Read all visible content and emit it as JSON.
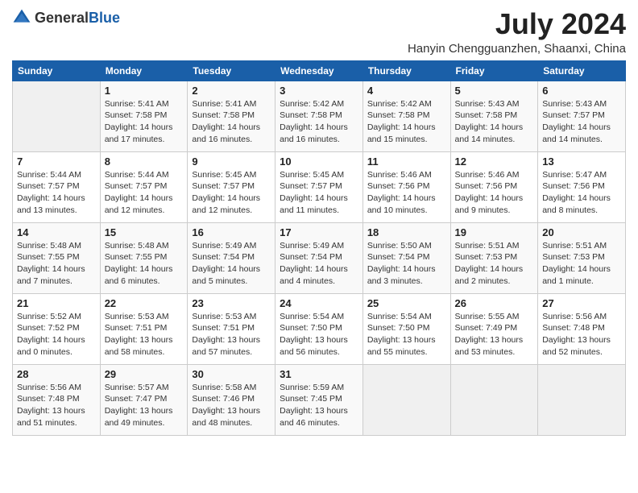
{
  "logo": {
    "general": "General",
    "blue": "Blue"
  },
  "header": {
    "month": "July 2024",
    "location": "Hanyin Chengguanzhen, Shaanxi, China"
  },
  "weekdays": [
    "Sunday",
    "Monday",
    "Tuesday",
    "Wednesday",
    "Thursday",
    "Friday",
    "Saturday"
  ],
  "weeks": [
    [
      {
        "day": "",
        "sunrise": "",
        "sunset": "",
        "daylight": ""
      },
      {
        "day": "1",
        "sunrise": "Sunrise: 5:41 AM",
        "sunset": "Sunset: 7:58 PM",
        "daylight": "Daylight: 14 hours and 17 minutes."
      },
      {
        "day": "2",
        "sunrise": "Sunrise: 5:41 AM",
        "sunset": "Sunset: 7:58 PM",
        "daylight": "Daylight: 14 hours and 16 minutes."
      },
      {
        "day": "3",
        "sunrise": "Sunrise: 5:42 AM",
        "sunset": "Sunset: 7:58 PM",
        "daylight": "Daylight: 14 hours and 16 minutes."
      },
      {
        "day": "4",
        "sunrise": "Sunrise: 5:42 AM",
        "sunset": "Sunset: 7:58 PM",
        "daylight": "Daylight: 14 hours and 15 minutes."
      },
      {
        "day": "5",
        "sunrise": "Sunrise: 5:43 AM",
        "sunset": "Sunset: 7:58 PM",
        "daylight": "Daylight: 14 hours and 14 minutes."
      },
      {
        "day": "6",
        "sunrise": "Sunrise: 5:43 AM",
        "sunset": "Sunset: 7:57 PM",
        "daylight": "Daylight: 14 hours and 14 minutes."
      }
    ],
    [
      {
        "day": "7",
        "sunrise": "Sunrise: 5:44 AM",
        "sunset": "Sunset: 7:57 PM",
        "daylight": "Daylight: 14 hours and 13 minutes."
      },
      {
        "day": "8",
        "sunrise": "Sunrise: 5:44 AM",
        "sunset": "Sunset: 7:57 PM",
        "daylight": "Daylight: 14 hours and 12 minutes."
      },
      {
        "day": "9",
        "sunrise": "Sunrise: 5:45 AM",
        "sunset": "Sunset: 7:57 PM",
        "daylight": "Daylight: 14 hours and 12 minutes."
      },
      {
        "day": "10",
        "sunrise": "Sunrise: 5:45 AM",
        "sunset": "Sunset: 7:57 PM",
        "daylight": "Daylight: 14 hours and 11 minutes."
      },
      {
        "day": "11",
        "sunrise": "Sunrise: 5:46 AM",
        "sunset": "Sunset: 7:56 PM",
        "daylight": "Daylight: 14 hours and 10 minutes."
      },
      {
        "day": "12",
        "sunrise": "Sunrise: 5:46 AM",
        "sunset": "Sunset: 7:56 PM",
        "daylight": "Daylight: 14 hours and 9 minutes."
      },
      {
        "day": "13",
        "sunrise": "Sunrise: 5:47 AM",
        "sunset": "Sunset: 7:56 PM",
        "daylight": "Daylight: 14 hours and 8 minutes."
      }
    ],
    [
      {
        "day": "14",
        "sunrise": "Sunrise: 5:48 AM",
        "sunset": "Sunset: 7:55 PM",
        "daylight": "Daylight: 14 hours and 7 minutes."
      },
      {
        "day": "15",
        "sunrise": "Sunrise: 5:48 AM",
        "sunset": "Sunset: 7:55 PM",
        "daylight": "Daylight: 14 hours and 6 minutes."
      },
      {
        "day": "16",
        "sunrise": "Sunrise: 5:49 AM",
        "sunset": "Sunset: 7:54 PM",
        "daylight": "Daylight: 14 hours and 5 minutes."
      },
      {
        "day": "17",
        "sunrise": "Sunrise: 5:49 AM",
        "sunset": "Sunset: 7:54 PM",
        "daylight": "Daylight: 14 hours and 4 minutes."
      },
      {
        "day": "18",
        "sunrise": "Sunrise: 5:50 AM",
        "sunset": "Sunset: 7:54 PM",
        "daylight": "Daylight: 14 hours and 3 minutes."
      },
      {
        "day": "19",
        "sunrise": "Sunrise: 5:51 AM",
        "sunset": "Sunset: 7:53 PM",
        "daylight": "Daylight: 14 hours and 2 minutes."
      },
      {
        "day": "20",
        "sunrise": "Sunrise: 5:51 AM",
        "sunset": "Sunset: 7:53 PM",
        "daylight": "Daylight: 14 hours and 1 minute."
      }
    ],
    [
      {
        "day": "21",
        "sunrise": "Sunrise: 5:52 AM",
        "sunset": "Sunset: 7:52 PM",
        "daylight": "Daylight: 14 hours and 0 minutes."
      },
      {
        "day": "22",
        "sunrise": "Sunrise: 5:53 AM",
        "sunset": "Sunset: 7:51 PM",
        "daylight": "Daylight: 13 hours and 58 minutes."
      },
      {
        "day": "23",
        "sunrise": "Sunrise: 5:53 AM",
        "sunset": "Sunset: 7:51 PM",
        "daylight": "Daylight: 13 hours and 57 minutes."
      },
      {
        "day": "24",
        "sunrise": "Sunrise: 5:54 AM",
        "sunset": "Sunset: 7:50 PM",
        "daylight": "Daylight: 13 hours and 56 minutes."
      },
      {
        "day": "25",
        "sunrise": "Sunrise: 5:54 AM",
        "sunset": "Sunset: 7:50 PM",
        "daylight": "Daylight: 13 hours and 55 minutes."
      },
      {
        "day": "26",
        "sunrise": "Sunrise: 5:55 AM",
        "sunset": "Sunset: 7:49 PM",
        "daylight": "Daylight: 13 hours and 53 minutes."
      },
      {
        "day": "27",
        "sunrise": "Sunrise: 5:56 AM",
        "sunset": "Sunset: 7:48 PM",
        "daylight": "Daylight: 13 hours and 52 minutes."
      }
    ],
    [
      {
        "day": "28",
        "sunrise": "Sunrise: 5:56 AM",
        "sunset": "Sunset: 7:48 PM",
        "daylight": "Daylight: 13 hours and 51 minutes."
      },
      {
        "day": "29",
        "sunrise": "Sunrise: 5:57 AM",
        "sunset": "Sunset: 7:47 PM",
        "daylight": "Daylight: 13 hours and 49 minutes."
      },
      {
        "day": "30",
        "sunrise": "Sunrise: 5:58 AM",
        "sunset": "Sunset: 7:46 PM",
        "daylight": "Daylight: 13 hours and 48 minutes."
      },
      {
        "day": "31",
        "sunrise": "Sunrise: 5:59 AM",
        "sunset": "Sunset: 7:45 PM",
        "daylight": "Daylight: 13 hours and 46 minutes."
      },
      {
        "day": "",
        "sunrise": "",
        "sunset": "",
        "daylight": ""
      },
      {
        "day": "",
        "sunrise": "",
        "sunset": "",
        "daylight": ""
      },
      {
        "day": "",
        "sunrise": "",
        "sunset": "",
        "daylight": ""
      }
    ]
  ]
}
